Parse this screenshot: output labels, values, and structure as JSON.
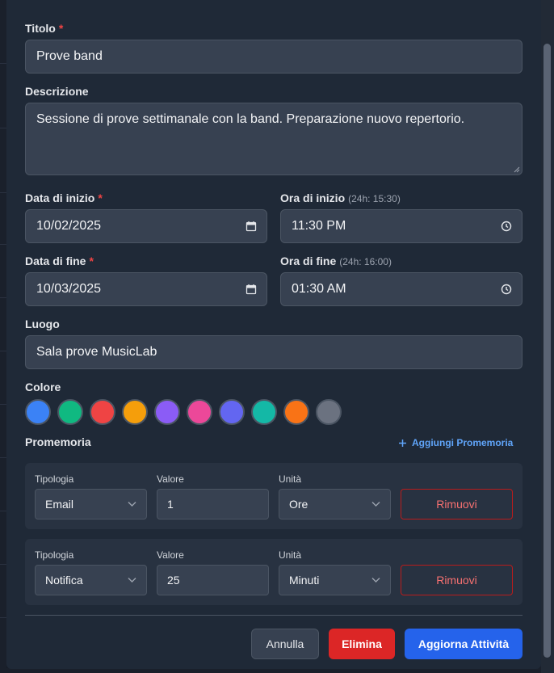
{
  "form": {
    "title_label": "Titolo",
    "required_mark": "*",
    "title_value": "Prove band",
    "description_label": "Descrizione",
    "description_value": "Sessione di prove settimanale con la band. Preparazione nuovo repertorio.",
    "start_date_label": "Data di inizio",
    "start_date_value": "10/02/2025",
    "start_time_label": "Ora di inizio",
    "start_time_hint": "(24h: 15:30)",
    "start_time_value": "11:30 PM",
    "end_date_label": "Data di fine",
    "end_date_value": "10/03/2025",
    "end_time_label": "Ora di fine",
    "end_time_hint": "(24h: 16:00)",
    "end_time_value": "01:30 AM",
    "location_label": "Luogo",
    "location_value": "Sala prove MusicLab",
    "color_label": "Colore",
    "colors": [
      "#3b82f6",
      "#10b981",
      "#ef4444",
      "#f59e0b",
      "#8b5cf6",
      "#ec4899",
      "#6366f1",
      "#14b8a6",
      "#f97316",
      "#6b7280"
    ],
    "selected_color": "#3b82f6"
  },
  "reminders": {
    "label": "Promemoria",
    "add_label": "Aggiungi Promemoria",
    "type_label": "Tipologia",
    "value_label": "Valore",
    "unit_label": "Unità",
    "remove_label": "Rimuovi",
    "items": [
      {
        "type": "Email",
        "value": "1",
        "unit": "Ore"
      },
      {
        "type": "Notifica",
        "value": "25",
        "unit": "Minuti"
      }
    ]
  },
  "actions": {
    "cancel_label": "Annulla",
    "delete_label": "Elimina",
    "update_label": "Aggiorna Attività",
    "cancel_bg": "#374151",
    "delete_bg": "#dc2626",
    "update_bg": "#2563eb"
  }
}
